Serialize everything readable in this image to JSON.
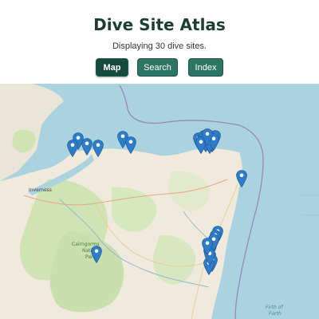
{
  "header": {
    "title": "Dive Site Atlas",
    "subtitle": "Displaying 30 dive sites."
  },
  "nav": {
    "buttons": [
      {
        "label": "Map",
        "active": true
      },
      {
        "label": "Search",
        "active": false
      },
      {
        "label": "Index",
        "active": false
      }
    ]
  },
  "map": {
    "labels": {
      "city": "Inverness",
      "park_line1": "Cairngorms",
      "park_line2": "Nati",
      "park_line3": "Par",
      "sea_line1": "Firth of",
      "sea_line2": "Forth"
    },
    "marker_icon": "map-pin-icon",
    "colors": {
      "marker": "#2f7dc9",
      "sea": "#aad3df",
      "accent": "#154b3b",
      "button": "#2e7563"
    }
  }
}
